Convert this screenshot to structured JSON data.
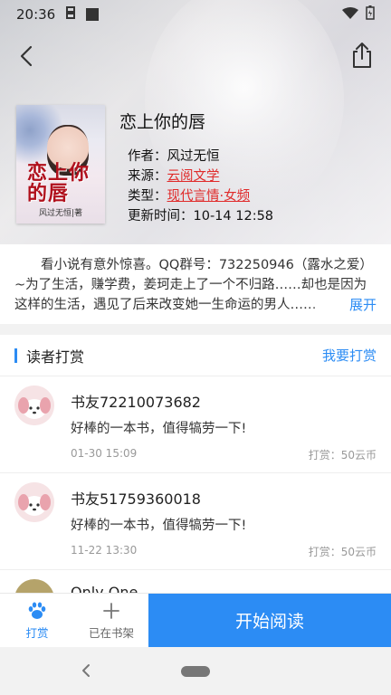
{
  "status": {
    "time": "20:36"
  },
  "book": {
    "title": "恋上你的唇",
    "cover_title": "恋上你的唇",
    "cover_author": "风过无恒|著",
    "author_label": "作者：",
    "author": "风过无恒",
    "source_label": "来源：",
    "source": "云阅文学",
    "type_label": "类型：",
    "type": "现代言情·女频",
    "updated_label": "更新时间：",
    "updated": "10-14 12:58"
  },
  "description": {
    "text": "看小说有意外惊喜。QQ群号：732250946（露水之爱）~为了生活，赚学费，姜珂走上了一个不归路……却也是因为这样的生活，遇见了后来改变她一生命运的男人……",
    "expand_label": "展开"
  },
  "rewards": {
    "title": "读者打赏",
    "action": "我要打赏",
    "items": [
      {
        "name": "书友72210073682",
        "message": "好棒的一本书，值得犒劳一下!",
        "time": "01-30 15:09",
        "amount": "打赏：50云币"
      },
      {
        "name": "书友51759360018",
        "message": "好棒的一本书，值得犒劳一下!",
        "time": "11-22 13:30",
        "amount": "打赏：50云币"
      },
      {
        "name": "Only One",
        "message": "",
        "time": "",
        "amount": ""
      }
    ]
  },
  "bottombar": {
    "reward_label": "打赏",
    "shelf_label": "已在书架",
    "start_label": "开始阅读"
  },
  "colors": {
    "accent": "#2c8cf4",
    "link": "#e02a2a"
  }
}
